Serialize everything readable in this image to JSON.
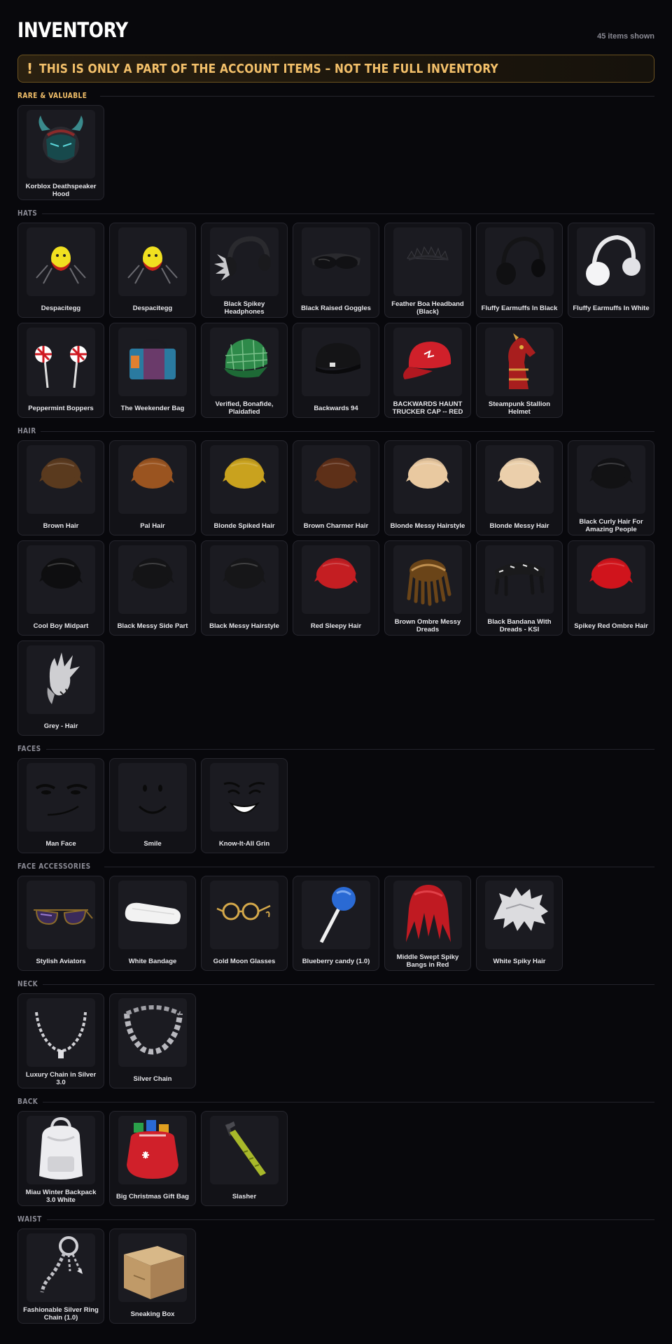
{
  "header": {
    "title": "INVENTORY",
    "count": "45 items shown"
  },
  "notice": {
    "icon": "exclamation-icon",
    "icon_glyph": "!",
    "text": "THIS IS ONLY A PART OF THE ACCOUNT ITEMS – NOT THE FULL INVENTORY",
    "color": "#f3c06a"
  },
  "sections": [
    {
      "title": "RARE & VALUABLE",
      "accent": "#f3c06a",
      "items": [
        {
          "name": "Korblox Deathspeaker Hood",
          "icon": "korblox-hood-icon"
        }
      ]
    },
    {
      "title": "HATS",
      "items": [
        {
          "name": "Despacitegg",
          "icon": "despacitegg-icon"
        },
        {
          "name": "Despacitegg",
          "icon": "despacitegg-icon"
        },
        {
          "name": "Black Spikey Headphones",
          "icon": "spikey-headphones-icon"
        },
        {
          "name": "Black Raised Goggles",
          "icon": "goggles-icon"
        },
        {
          "name": "Feather Boa Headband (Black)",
          "icon": "feather-headband-icon"
        },
        {
          "name": "Fluffy Earmuffs In Black",
          "icon": "earmuffs-black-icon"
        },
        {
          "name": "Fluffy Earmuffs In White",
          "icon": "earmuffs-white-icon"
        },
        {
          "name": "Peppermint Boppers",
          "icon": "peppermint-boppers-icon"
        },
        {
          "name": "The Weekender Bag",
          "icon": "weekender-bag-icon"
        },
        {
          "name": "Verified, Bonafide, Plaidafied",
          "icon": "plaid-cap-icon"
        },
        {
          "name": "Backwards 94",
          "icon": "black-cap-icon"
        },
        {
          "name": "BACKWARDS HAUNT TRUCKER CAP -- RED",
          "icon": "red-cap-icon"
        },
        {
          "name": "Steampunk Stallion Helmet",
          "icon": "stallion-helmet-icon"
        }
      ]
    },
    {
      "title": "HAIR",
      "items": [
        {
          "name": "Brown Hair",
          "icon": "hair-icon",
          "color": "#5a3a1e"
        },
        {
          "name": "Pal Hair",
          "icon": "hair-icon",
          "color": "#9a5420"
        },
        {
          "name": "Blonde Spiked Hair",
          "icon": "hair-icon",
          "color": "#c9a21e"
        },
        {
          "name": "Brown Charmer Hair",
          "icon": "hair-icon",
          "color": "#5e3018"
        },
        {
          "name": "Blonde Messy Hairstyle",
          "icon": "hair-icon",
          "color": "#e9c9a0"
        },
        {
          "name": "Blonde Messy Hair",
          "icon": "hair-icon",
          "color": "#ebcfab"
        },
        {
          "name": "Black Curly Hair For Amazing People",
          "icon": "hair-icon",
          "color": "#121214"
        },
        {
          "name": "Cool Boy Midpart",
          "icon": "hair-icon",
          "color": "#0e0e10"
        },
        {
          "name": "Black Messy Side Part",
          "icon": "hair-icon",
          "color": "#141416"
        },
        {
          "name": "Black Messy Hairstyle",
          "icon": "hair-icon",
          "color": "#161618"
        },
        {
          "name": "Red Sleepy Hair",
          "icon": "hair-icon",
          "color": "#c41e22"
        },
        {
          "name": "Brown Ombre Messy Dreads",
          "icon": "dreads-icon",
          "color": "#6a4418"
        },
        {
          "name": "Black Bandana With Dreads - KSI",
          "icon": "bandana-dreads-icon",
          "color": "#121214"
        },
        {
          "name": "Spikey Red Ombre Hair",
          "icon": "hair-icon",
          "color": "#d0141c"
        },
        {
          "name": "Grey - Hair",
          "icon": "grey-hair-icon",
          "color": "#c9c9cc"
        }
      ]
    },
    {
      "title": "FACES",
      "items": [
        {
          "name": "Man Face",
          "icon": "man-face-icon"
        },
        {
          "name": "Smile",
          "icon": "smile-face-icon"
        },
        {
          "name": "Know-It-All Grin",
          "icon": "grin-face-icon"
        }
      ]
    },
    {
      "title": "FACE ACCESSORIES",
      "items": [
        {
          "name": "Stylish Aviators",
          "icon": "aviators-icon"
        },
        {
          "name": "White Bandage",
          "icon": "bandage-icon"
        },
        {
          "name": "Gold Moon Glasses",
          "icon": "gold-glasses-icon"
        },
        {
          "name": "Blueberry candy (1.0)",
          "icon": "lollipop-icon"
        },
        {
          "name": "Middle Swept Spiky Bangs in Red",
          "icon": "red-bangs-icon"
        },
        {
          "name": "White Spiky Hair",
          "icon": "white-spiky-hair-icon"
        }
      ]
    },
    {
      "title": "NECK",
      "items": [
        {
          "name": "Luxury Chain in Silver 3.0",
          "icon": "chain-necklace-icon"
        },
        {
          "name": "Silver Chain",
          "icon": "silver-chain-icon"
        }
      ]
    },
    {
      "title": "BACK",
      "items": [
        {
          "name": "Miau Winter Backpack 3.0 White",
          "icon": "backpack-icon"
        },
        {
          "name": "Big Christmas Gift Bag",
          "icon": "gift-bag-icon"
        },
        {
          "name": "Slasher",
          "icon": "slasher-icon"
        }
      ]
    },
    {
      "title": "WAIST",
      "items": [
        {
          "name": "Fashionable Silver Ring Chain (1.0)",
          "icon": "ring-chain-icon"
        },
        {
          "name": "Sneaking Box",
          "icon": "cardboard-box-icon"
        }
      ]
    }
  ]
}
